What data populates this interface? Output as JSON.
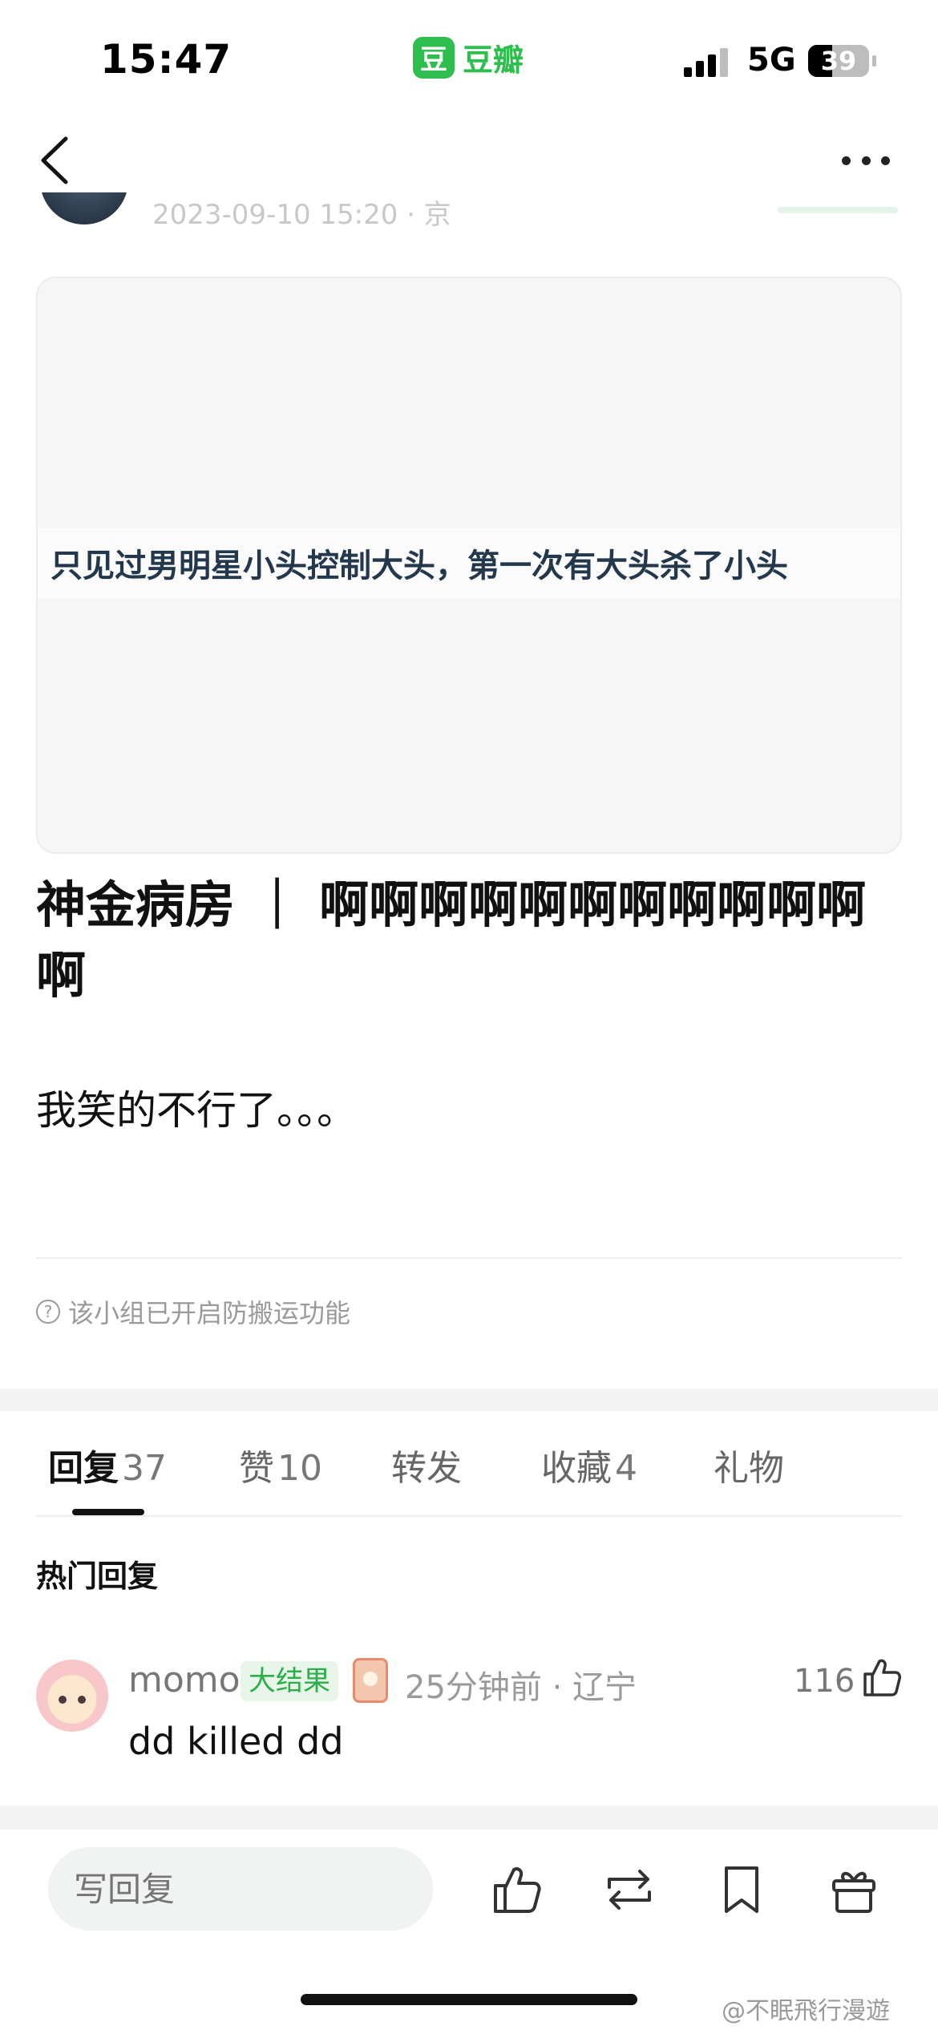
{
  "status_bar": {
    "time": "15:47",
    "app_logo_char": "豆",
    "app_name": "豆瓣",
    "network": "5G",
    "battery_level": "39",
    "battery_fraction": 0.39,
    "accent_color": "#2dbe4d"
  },
  "nav": {
    "back_icon": "chevron-left-icon",
    "more_icon": "more-dots-icon"
  },
  "author": {
    "meta_partial": "2023-09-10 15:20 · 京"
  },
  "post": {
    "image_caption": "只见过男明星小头控制大头，第一次有大头杀了小头",
    "title": "神金病房 ｜ 啊啊啊啊啊啊啊啊啊啊啊啊",
    "body": "我笑的不行了。。。",
    "notice": "该小组已开启防搬运功能",
    "notice_icon": "question-circle-icon"
  },
  "tabs": [
    {
      "label": "回复",
      "count": "37"
    },
    {
      "label": "赞",
      "count": "10"
    },
    {
      "label": "转发",
      "count": ""
    },
    {
      "label": "收藏",
      "count": "4"
    },
    {
      "label": "礼物",
      "count": ""
    }
  ],
  "hot_replies": {
    "title": "热门回复",
    "items": [
      {
        "user": "momo",
        "badge": "大结果",
        "time_location": "25分钟前 · 辽宁",
        "likes": "116",
        "text": "dd killed dd"
      }
    ]
  },
  "bottom_bar": {
    "reply_placeholder": "写回复",
    "icons": [
      "thumbs-up-icon",
      "repost-icon",
      "bookmark-icon",
      "gift-icon"
    ]
  },
  "watermark": "@不眠飛行漫遊"
}
